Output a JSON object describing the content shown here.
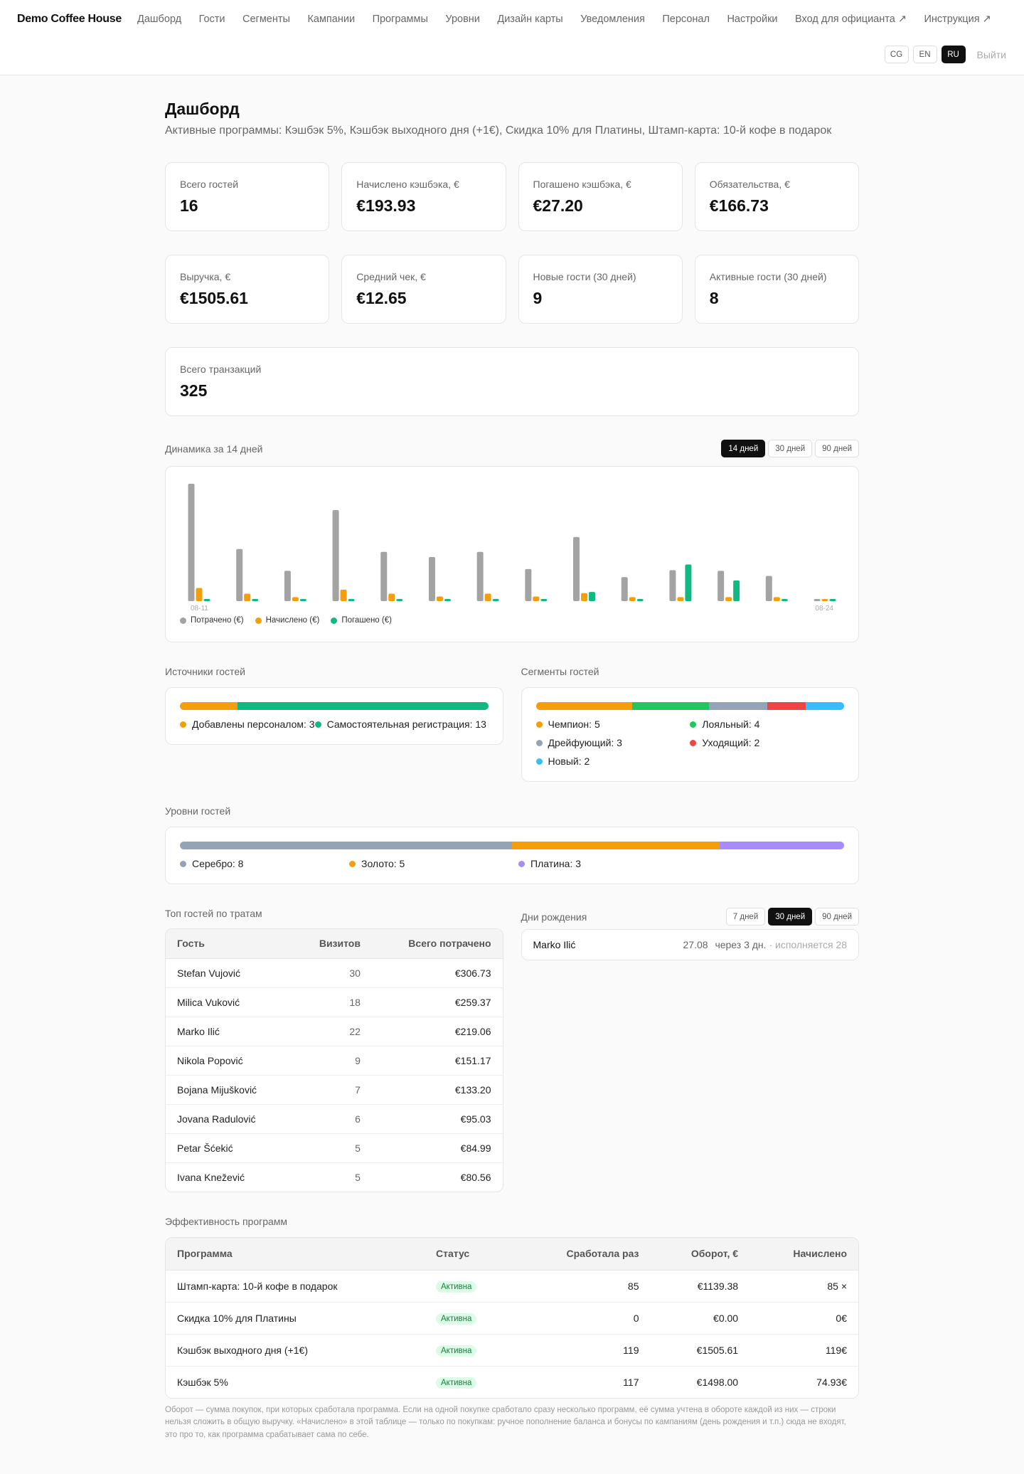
{
  "header": {
    "brand": "Demo Coffee House",
    "nav": [
      "Дашборд",
      "Гости",
      "Сегменты",
      "Кампании",
      "Программы",
      "Уровни",
      "Дизайн карты",
      "Уведомления",
      "Персонал",
      "Настройки",
      "Вход для официанта ↗",
      "Инструкция ↗"
    ],
    "langs": [
      "CG",
      "EN",
      "RU"
    ],
    "active_lang": "RU",
    "logout": "Выйти"
  },
  "page": {
    "title": "Дашборд",
    "subtitle": "Активные программы: Кэшбэк 5%, Кэшбэк выходного дня (+1€), Скидка 10% для Платины, Штамп-карта: 10-й кофе в подарок"
  },
  "stats": [
    {
      "label": "Всего гостей",
      "value": "16"
    },
    {
      "label": "Начислено кэшбэка, €",
      "value": "€193.93"
    },
    {
      "label": "Погашено кэшбэка, €",
      "value": "€27.20"
    },
    {
      "label": "Обязательства, €",
      "value": "€166.73"
    },
    {
      "label": "Выручка, €",
      "value": "€1505.61"
    },
    {
      "label": "Средний чек, €",
      "value": "€12.65"
    },
    {
      "label": "Новые гости (30 дней)",
      "value": "9"
    },
    {
      "label": "Активные гости (30 дней)",
      "value": "8"
    },
    {
      "label": "Всего транзакций",
      "value": "325"
    }
  ],
  "dynamics": {
    "title": "Динамика за 14 дней",
    "ranges": [
      "14 дней",
      "30 дней",
      "90 дней"
    ],
    "active_range": "14 дней"
  },
  "chart_data": {
    "type": "bar",
    "categories": [
      "08-11",
      "08-12",
      "08-13",
      "08-14",
      "08-15",
      "08-16",
      "08-17",
      "08-18",
      "08-19",
      "08-20",
      "08-21",
      "08-22",
      "08-23",
      "08-24"
    ],
    "tick_labels": [
      "08-11",
      "08-24"
    ],
    "series": [
      {
        "name": "Потрачено (€)",
        "color": "#a3a3a3",
        "values": [
          205,
          91,
          53,
          159,
          86,
          77,
          86,
          56,
          112,
          42,
          54,
          53,
          44,
          3
        ]
      },
      {
        "name": "Начислено (€)",
        "color": "#f59e0b",
        "values": [
          23,
          13,
          7,
          20,
          13,
          8,
          13,
          8,
          14,
          7,
          7,
          7,
          7,
          3
        ]
      },
      {
        "name": "Погашено (€)",
        "color": "#10b981",
        "values": [
          3,
          3,
          3,
          3,
          3,
          3,
          3,
          3,
          16,
          3,
          64,
          36,
          3,
          3
        ]
      }
    ],
    "ylim": [
      0,
      210
    ]
  },
  "sources": {
    "title": "Источники гостей",
    "items": [
      {
        "label": "Добавлены персоналом: 3",
        "value": 3,
        "color": "#f59e0b"
      },
      {
        "label": "Самостоятельная регистрация: 13",
        "value": 13,
        "color": "#10b981"
      }
    ]
  },
  "segments": {
    "title": "Сегменты гостей",
    "items": [
      {
        "label": "Чемпион: 5",
        "value": 5,
        "color": "#f59e0b"
      },
      {
        "label": "Лояльный: 4",
        "value": 4,
        "color": "#22c55e"
      },
      {
        "label": "Дрейфующий: 3",
        "value": 3,
        "color": "#94a3b8"
      },
      {
        "label": "Уходящий: 2",
        "value": 2,
        "color": "#ef4444"
      },
      {
        "label": "Новый: 2",
        "value": 2,
        "color": "#38bdf8"
      }
    ]
  },
  "tiers": {
    "title": "Уровни гостей",
    "items": [
      {
        "label": "Серебро: 8",
        "value": 8,
        "color": "#94a3b8"
      },
      {
        "label": "Золото: 5",
        "value": 5,
        "color": "#f59e0b"
      },
      {
        "label": "Платина: 3",
        "value": 3,
        "color": "#a78bfa"
      }
    ]
  },
  "top_guests": {
    "title": "Топ гостей по тратам",
    "headers": [
      "Гость",
      "Визитов",
      "Всего потрачено"
    ],
    "rows": [
      [
        "Stefan Vujović",
        "30",
        "€306.73"
      ],
      [
        "Milica Vuković",
        "18",
        "€259.37"
      ],
      [
        "Marko Ilić",
        "22",
        "€219.06"
      ],
      [
        "Nikola Popović",
        "9",
        "€151.17"
      ],
      [
        "Bojana Mijušković",
        "7",
        "€133.20"
      ],
      [
        "Jovana Radulović",
        "6",
        "€95.03"
      ],
      [
        "Petar Šćekić",
        "5",
        "€84.99"
      ],
      [
        "Ivana Knežević",
        "5",
        "€80.56"
      ]
    ]
  },
  "birthdays": {
    "title": "Дни рождения",
    "ranges": [
      "7 дней",
      "30 дней",
      "90 дней"
    ],
    "active_range": "30 дней",
    "items": [
      {
        "name": "Marko Ilić",
        "date": "27.08",
        "when": "через 3 дн.",
        "age": "· исполняется 28"
      }
    ]
  },
  "programs": {
    "title": "Эффективность программ",
    "headers": [
      "Программа",
      "Статус",
      "Сработала раз",
      "Оборот, €",
      "Начислено"
    ],
    "rows": [
      [
        "Штамп-карта: 10-й кофе в подарок",
        "Активна",
        "85",
        "€1139.38",
        "85 ×"
      ],
      [
        "Скидка 10% для Платины",
        "Активна",
        "0",
        "€0.00",
        "0€"
      ],
      [
        "Кэшбэк выходного дня (+1€)",
        "Активна",
        "119",
        "€1505.61",
        "119€"
      ],
      [
        "Кэшбэк 5%",
        "Активна",
        "117",
        "€1498.00",
        "74.93€"
      ]
    ],
    "note": "Оборот — сумма покупок, при которых сработала программа. Если на одной покупке сработало сразу несколько программ, её сумма учтена в обороте каждой из них — строки нельзя сложить в общую выручку. «Начислено» в этой таблице — только по покупкам: ручное пополнение баланса и бонусы по кампаниям (день рождения и т.п.) сюда не входят, это про то, как программа срабатывает сама по себе."
  }
}
